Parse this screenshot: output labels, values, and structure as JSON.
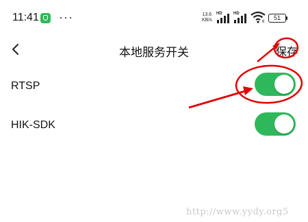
{
  "status_bar": {
    "time": "11:41",
    "dots": "···",
    "speed_value": "13.6",
    "speed_unit": "KB/s",
    "hd_label": "HD",
    "wifi_label": "6",
    "battery": "51"
  },
  "header": {
    "back_icon": "chevron-left-icon",
    "title": "本地服务开关",
    "save_label": "保存"
  },
  "settings": [
    {
      "label": "RTSP",
      "enabled": true
    },
    {
      "label": "HIK-SDK",
      "enabled": true
    }
  ],
  "colors": {
    "toggle_on": "#2fb85b",
    "annotation": "#e00000"
  },
  "watermark": "http://www.yydy.org5"
}
